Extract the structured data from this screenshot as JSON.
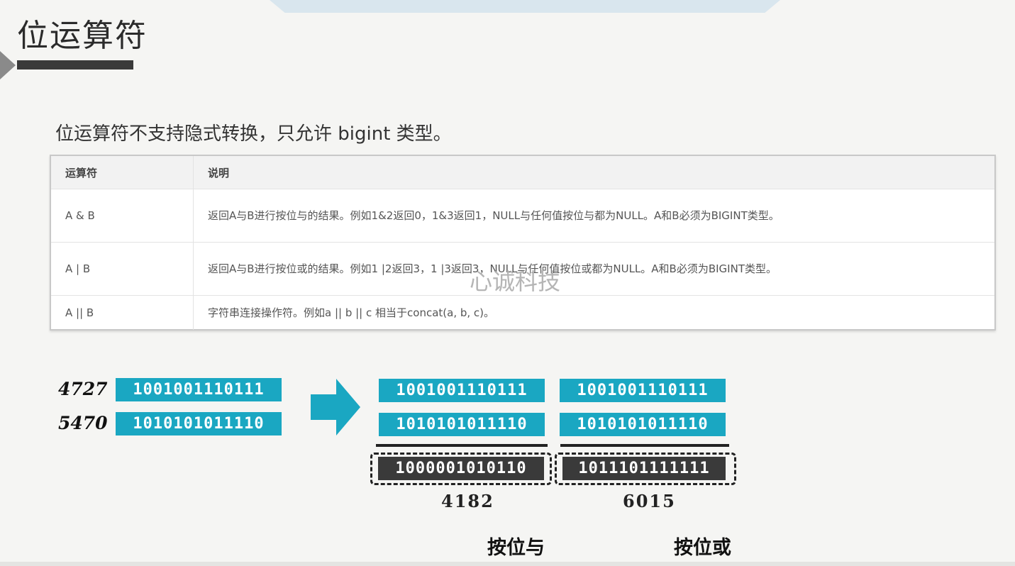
{
  "slide": {
    "title": "位运算符"
  },
  "intro": "位运算符不支持隐式转换，只允许 bigint 类型。",
  "table": {
    "headers": [
      "运算符",
      "说明"
    ],
    "rows": [
      {
        "op": "A & B",
        "desc": "返回A与B进行按位与的结果。例如1&2返回0，1&3返回1，NULL与任何值按位与都为NULL。A和B必须为BIGINT类型。"
      },
      {
        "op": "A | B",
        "desc": "返回A与B进行按位或的结果。例如1 |2返回3，1 |3返回3，NULL与任何值按位或都为NULL。A和B必须为BIGINT类型。"
      },
      {
        "op": "A || B",
        "desc": "字符串连接操作符。例如a || b || c 相当于concat(a, b, c)。"
      }
    ]
  },
  "watermark": "心诚科技",
  "diagram": {
    "inputs": [
      {
        "decimal": "4727",
        "binary": "1001001110111"
      },
      {
        "decimal": "5470",
        "binary": "1010101011110"
      }
    ],
    "and_block": {
      "operands": [
        "1001001110111",
        "1010101011110"
      ],
      "result_binary": "1000001010110",
      "result_decimal": "4182",
      "label": "按位与"
    },
    "or_block": {
      "operands": [
        "1001001110111",
        "1010101011110"
      ],
      "result_binary": "1011101111111",
      "result_decimal": "6015",
      "label": "按位或"
    },
    "colors": {
      "bit_box": "#1aa7c2",
      "result_box": "#3a3a3a",
      "arrow": "#1aa7c2"
    }
  }
}
